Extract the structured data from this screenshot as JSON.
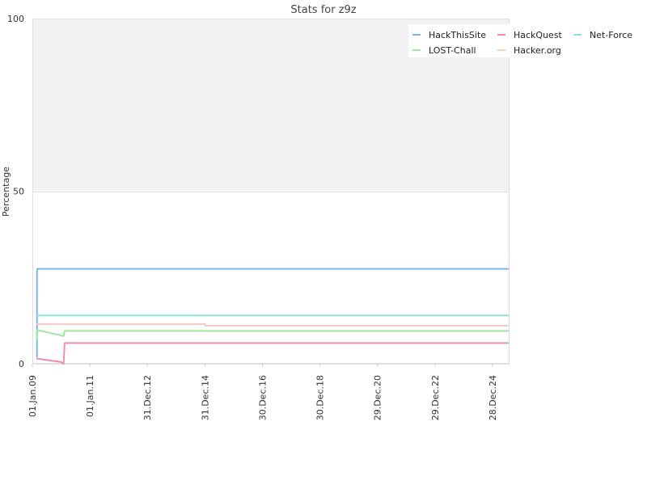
{
  "chart_data": {
    "type": "line",
    "title": "Stats for z9z",
    "xlabel": "",
    "ylabel": "Percentage",
    "ylim": [
      0,
      100
    ],
    "xlim": [
      "2009-01-01",
      "2025-08-01"
    ],
    "y_ticks": [
      0,
      50,
      100
    ],
    "x_ticks": [
      {
        "date": "2009-01-01",
        "label": "01.Jan.09"
      },
      {
        "date": "2011-01-01",
        "label": "01.Jan.11"
      },
      {
        "date": "2012-12-31",
        "label": "31.Dec.12"
      },
      {
        "date": "2014-12-31",
        "label": "31.Dec.14"
      },
      {
        "date": "2016-12-30",
        "label": "30.Dec.16"
      },
      {
        "date": "2018-12-30",
        "label": "30.Dec.18"
      },
      {
        "date": "2020-12-29",
        "label": "29.Dec.20"
      },
      {
        "date": "2022-12-29",
        "label": "29.Dec.22"
      },
      {
        "date": "2024-12-28",
        "label": "28.Dec.24"
      }
    ],
    "background_bands": [
      {
        "from": 50,
        "to": 100,
        "color": "#f2f2f2"
      }
    ],
    "grid": true,
    "legend_position": "top-right",
    "series": [
      {
        "name": "HackThisSite",
        "color": "#7cb5ec",
        "points": [
          [
            "2009-03-01",
            2
          ],
          [
            "2009-03-02",
            26
          ],
          [
            "2009-03-05",
            27.5
          ],
          [
            "2025-07-15",
            27.5
          ]
        ]
      },
      {
        "name": "HackQuest",
        "color": "#f08cb4",
        "points": [
          [
            "2009-03-01",
            1.5
          ],
          [
            "2010-01-01",
            0.5
          ],
          [
            "2010-02-01",
            0
          ],
          [
            "2010-02-15",
            6
          ],
          [
            "2025-07-15",
            6
          ]
        ]
      },
      {
        "name": "Net-Force",
        "color": "#8ee3d8",
        "points": [
          [
            "2009-03-01",
            14
          ],
          [
            "2025-07-15",
            14
          ]
        ]
      },
      {
        "name": "LOST-Chall",
        "color": "#9ee89a",
        "points": [
          [
            "2009-03-01",
            7
          ],
          [
            "2009-03-05",
            9.8
          ],
          [
            "2010-02-01",
            8
          ],
          [
            "2010-02-15",
            9.5
          ],
          [
            "2025-07-15",
            9.5
          ]
        ]
      },
      {
        "name": "Hacker.org",
        "color": "#f8c8c8",
        "points": [
          [
            "2009-03-01",
            11.5
          ],
          [
            "2014-12-31",
            11.5
          ],
          [
            "2015-01-05",
            11
          ],
          [
            "2025-07-15",
            11
          ]
        ]
      }
    ]
  }
}
